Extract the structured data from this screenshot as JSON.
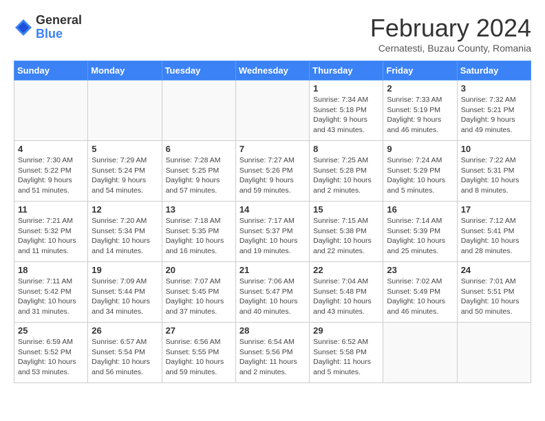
{
  "logo": {
    "general": "General",
    "blue": "Blue"
  },
  "title": {
    "month_year": "February 2024",
    "location": "Cernatesti, Buzau County, Romania"
  },
  "weekdays": [
    "Sunday",
    "Monday",
    "Tuesday",
    "Wednesday",
    "Thursday",
    "Friday",
    "Saturday"
  ],
  "weeks": [
    [
      {
        "num": "",
        "detail": ""
      },
      {
        "num": "",
        "detail": ""
      },
      {
        "num": "",
        "detail": ""
      },
      {
        "num": "",
        "detail": ""
      },
      {
        "num": "1",
        "detail": "Sunrise: 7:34 AM\nSunset: 5:18 PM\nDaylight: 9 hours\nand 43 minutes."
      },
      {
        "num": "2",
        "detail": "Sunrise: 7:33 AM\nSunset: 5:19 PM\nDaylight: 9 hours\nand 46 minutes."
      },
      {
        "num": "3",
        "detail": "Sunrise: 7:32 AM\nSunset: 5:21 PM\nDaylight: 9 hours\nand 49 minutes."
      }
    ],
    [
      {
        "num": "4",
        "detail": "Sunrise: 7:30 AM\nSunset: 5:22 PM\nDaylight: 9 hours\nand 51 minutes."
      },
      {
        "num": "5",
        "detail": "Sunrise: 7:29 AM\nSunset: 5:24 PM\nDaylight: 9 hours\nand 54 minutes."
      },
      {
        "num": "6",
        "detail": "Sunrise: 7:28 AM\nSunset: 5:25 PM\nDaylight: 9 hours\nand 57 minutes."
      },
      {
        "num": "7",
        "detail": "Sunrise: 7:27 AM\nSunset: 5:26 PM\nDaylight: 9 hours\nand 59 minutes."
      },
      {
        "num": "8",
        "detail": "Sunrise: 7:25 AM\nSunset: 5:28 PM\nDaylight: 10 hours\nand 2 minutes."
      },
      {
        "num": "9",
        "detail": "Sunrise: 7:24 AM\nSunset: 5:29 PM\nDaylight: 10 hours\nand 5 minutes."
      },
      {
        "num": "10",
        "detail": "Sunrise: 7:22 AM\nSunset: 5:31 PM\nDaylight: 10 hours\nand 8 minutes."
      }
    ],
    [
      {
        "num": "11",
        "detail": "Sunrise: 7:21 AM\nSunset: 5:32 PM\nDaylight: 10 hours\nand 11 minutes."
      },
      {
        "num": "12",
        "detail": "Sunrise: 7:20 AM\nSunset: 5:34 PM\nDaylight: 10 hours\nand 14 minutes."
      },
      {
        "num": "13",
        "detail": "Sunrise: 7:18 AM\nSunset: 5:35 PM\nDaylight: 10 hours\nand 16 minutes."
      },
      {
        "num": "14",
        "detail": "Sunrise: 7:17 AM\nSunset: 5:37 PM\nDaylight: 10 hours\nand 19 minutes."
      },
      {
        "num": "15",
        "detail": "Sunrise: 7:15 AM\nSunset: 5:38 PM\nDaylight: 10 hours\nand 22 minutes."
      },
      {
        "num": "16",
        "detail": "Sunrise: 7:14 AM\nSunset: 5:39 PM\nDaylight: 10 hours\nand 25 minutes."
      },
      {
        "num": "17",
        "detail": "Sunrise: 7:12 AM\nSunset: 5:41 PM\nDaylight: 10 hours\nand 28 minutes."
      }
    ],
    [
      {
        "num": "18",
        "detail": "Sunrise: 7:11 AM\nSunset: 5:42 PM\nDaylight: 10 hours\nand 31 minutes."
      },
      {
        "num": "19",
        "detail": "Sunrise: 7:09 AM\nSunset: 5:44 PM\nDaylight: 10 hours\nand 34 minutes."
      },
      {
        "num": "20",
        "detail": "Sunrise: 7:07 AM\nSunset: 5:45 PM\nDaylight: 10 hours\nand 37 minutes."
      },
      {
        "num": "21",
        "detail": "Sunrise: 7:06 AM\nSunset: 5:47 PM\nDaylight: 10 hours\nand 40 minutes."
      },
      {
        "num": "22",
        "detail": "Sunrise: 7:04 AM\nSunset: 5:48 PM\nDaylight: 10 hours\nand 43 minutes."
      },
      {
        "num": "23",
        "detail": "Sunrise: 7:02 AM\nSunset: 5:49 PM\nDaylight: 10 hours\nand 46 minutes."
      },
      {
        "num": "24",
        "detail": "Sunrise: 7:01 AM\nSunset: 5:51 PM\nDaylight: 10 hours\nand 50 minutes."
      }
    ],
    [
      {
        "num": "25",
        "detail": "Sunrise: 6:59 AM\nSunset: 5:52 PM\nDaylight: 10 hours\nand 53 minutes."
      },
      {
        "num": "26",
        "detail": "Sunrise: 6:57 AM\nSunset: 5:54 PM\nDaylight: 10 hours\nand 56 minutes."
      },
      {
        "num": "27",
        "detail": "Sunrise: 6:56 AM\nSunset: 5:55 PM\nDaylight: 10 hours\nand 59 minutes."
      },
      {
        "num": "28",
        "detail": "Sunrise: 6:54 AM\nSunset: 5:56 PM\nDaylight: 11 hours\nand 2 minutes."
      },
      {
        "num": "29",
        "detail": "Sunrise: 6:52 AM\nSunset: 5:58 PM\nDaylight: 11 hours\nand 5 minutes."
      },
      {
        "num": "",
        "detail": ""
      },
      {
        "num": "",
        "detail": ""
      }
    ]
  ]
}
